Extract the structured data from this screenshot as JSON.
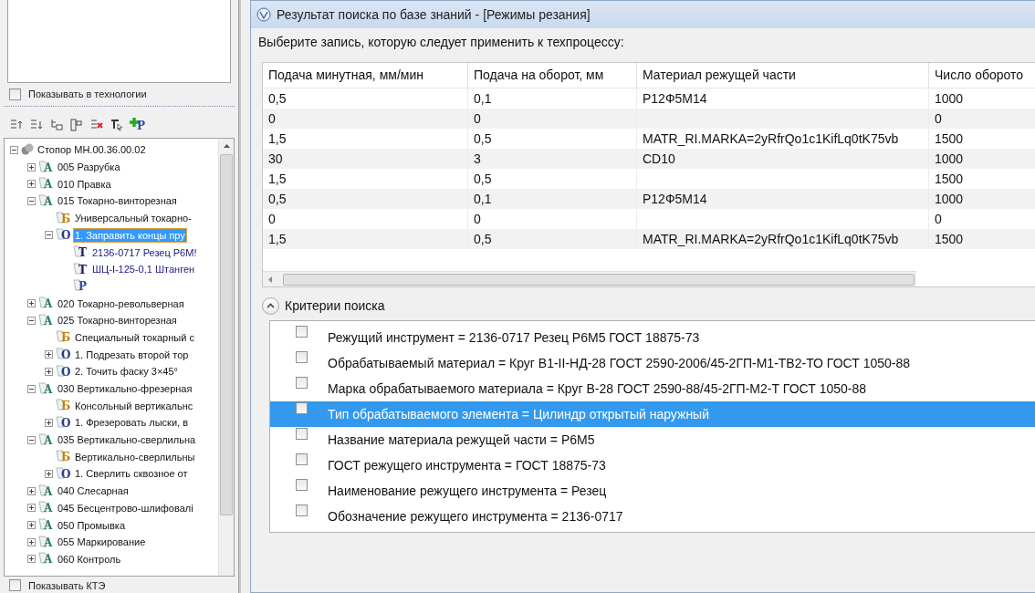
{
  "left_panel": {
    "show_in_technology": {
      "label": "Показывать в технологии",
      "checked": false
    },
    "toolbar": {
      "add_badge": "P"
    },
    "tree": [
      {
        "kind": "root",
        "text": "Стопор МН.00.36.00.02",
        "expanded": true,
        "selected": false,
        "children": [
          {
            "kind": "operation",
            "badge": "A",
            "text": "005 Разрубка",
            "expanded": false,
            "selected": false
          },
          {
            "kind": "operation",
            "badge": "A",
            "text": "010 Правка",
            "expanded": false,
            "selected": false
          },
          {
            "kind": "operation",
            "badge": "A",
            "text": "015 Токарно-винторезная",
            "expanded": true,
            "selected": false,
            "children": [
              {
                "kind": "equipment",
                "badge": "Б",
                "text": "Универсальный токарно-",
                "selected": false
              },
              {
                "kind": "step",
                "badge": "O",
                "text": "1. Заправить концы пру",
                "expanded": true,
                "selected": true,
                "children": [
                  {
                    "kind": "tool",
                    "badge": "T",
                    "text": "2136-0717 Резец Р6М!",
                    "selected": false
                  },
                  {
                    "kind": "tool",
                    "badge": "T",
                    "text": "ШЦ-I-125-0,1 Штанген",
                    "selected": false
                  },
                  {
                    "kind": "param",
                    "badge": "P",
                    "selected": false
                  }
                ]
              }
            ]
          },
          {
            "kind": "operation",
            "badge": "A",
            "text": "020 Токарно-револьверная",
            "expanded": false,
            "selected": false
          },
          {
            "kind": "operation",
            "badge": "A",
            "text": "025 Токарно-винторезная",
            "expanded": true,
            "selected": false,
            "children": [
              {
                "kind": "equipment",
                "badge": "Б",
                "text": "Специальный токарный с",
                "selected": false
              },
              {
                "kind": "step",
                "badge": "O",
                "text": "1. Подрезать второй тор",
                "expanded": false,
                "selected": false
              },
              {
                "kind": "step",
                "badge": "O",
                "text": "2. Точить фаску 3×45°",
                "expanded": false,
                "selected": false
              }
            ]
          },
          {
            "kind": "operation",
            "badge": "A",
            "text": "030 Вертикально-фрезерная",
            "expanded": true,
            "selected": false,
            "children": [
              {
                "kind": "equipment",
                "badge": "Б",
                "text": "Консольный вертикальнс",
                "selected": false
              },
              {
                "kind": "step",
                "badge": "O",
                "text": "1. Фрезеровать лыски, в",
                "expanded": false,
                "selected": false
              }
            ]
          },
          {
            "kind": "operation",
            "badge": "A",
            "text": "035 Вертикально-сверлильна",
            "expanded": true,
            "selected": false,
            "children": [
              {
                "kind": "equipment",
                "badge": "Б",
                "text": "Вертикально-сверлильны",
                "selected": false
              },
              {
                "kind": "step",
                "badge": "O",
                "text": "1. Сверлить сквозное от",
                "expanded": false,
                "selected": false
              }
            ]
          },
          {
            "kind": "operation",
            "badge": "A",
            "text": "040 Слесарная",
            "expanded": false,
            "selected": false
          },
          {
            "kind": "operation",
            "badge": "A",
            "text": "045 Бесцентрово-шлифовалі",
            "expanded": false,
            "selected": false
          },
          {
            "kind": "operation",
            "badge": "A",
            "text": "050 Промывка",
            "expanded": false,
            "selected": false
          },
          {
            "kind": "operation",
            "badge": "A",
            "text": "055 Маркирование",
            "expanded": false,
            "selected": false
          },
          {
            "kind": "operation",
            "badge": "A",
            "text": "060 Контроль",
            "expanded": false,
            "selected": false
          }
        ]
      }
    ],
    "show_kte": {
      "label": "Показывать КТЭ",
      "checked": false
    }
  },
  "dialog": {
    "title": "Результат поиска по базе знаний - [Режимы резания]",
    "prompt": "Выберите запись, которую следует применить к техпроцессу:",
    "table": {
      "columns": [
        "Подача минутная, мм/мин",
        "Подача на оборот, мм",
        "Материал режущей части",
        "Число оборото"
      ],
      "rows": [
        [
          "0,5",
          "0,1",
          "Р12Ф5М14",
          "1000"
        ],
        [
          "0",
          "0",
          "",
          "0"
        ],
        [
          "1,5",
          "0,5",
          "MATR_RI.MARKA=2yRfrQo1c1KifLq0tK75vb",
          "1500"
        ],
        [
          "30",
          "3",
          "CD10",
          "1000"
        ],
        [
          "1,5",
          "0,5",
          "",
          "1500"
        ],
        [
          "0,5",
          "0,1",
          "Р12Ф5М14",
          "1000"
        ],
        [
          "0",
          "0",
          "",
          "0"
        ],
        [
          "1,5",
          "0,5",
          "MATR_RI.MARKA=2yRfrQo1c1KifLq0tK75vb",
          "1500"
        ]
      ]
    },
    "criteria": {
      "title": "Критерии поиска",
      "expanded": true,
      "items": [
        {
          "text": "Режущий инструмент = 2136-0717 Резец Р6М5 ГОСТ 18875-73",
          "checked": false,
          "selected": false
        },
        {
          "text": "Обрабатываемый материал = Круг В1-II-НД-28 ГОСТ 2590-2006/45-2ГП-М1-ТВ2-ТО ГОСТ 1050-88",
          "checked": false,
          "selected": false
        },
        {
          "text": "Марка обрабатываемого материала = Круг В-28 ГОСТ 2590-88/45-2ГП-М2-Т ГОСТ 1050-88",
          "checked": false,
          "selected": false
        },
        {
          "text": "Тип обрабатываемого элемента = Цилиндр открытый наружный",
          "checked": false,
          "selected": true
        },
        {
          "text": "Название материала режущей части = Р6М5",
          "checked": false,
          "selected": false
        },
        {
          "text": "ГОСТ режущего инструмента = ГОСТ 18875-73",
          "checked": false,
          "selected": false
        },
        {
          "text": "Наименование режущего инструмента = Резец",
          "checked": false,
          "selected": false
        },
        {
          "text": "Обозначение режущего инструмента = 2136-0717",
          "checked": false,
          "selected": false
        }
      ]
    }
  }
}
